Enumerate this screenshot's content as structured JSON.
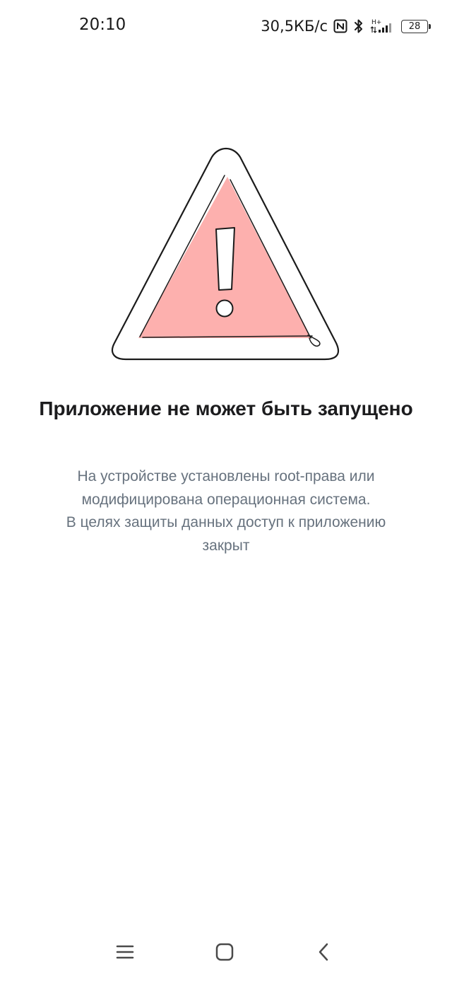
{
  "status_bar": {
    "time": "20:10",
    "network_speed": "30,5КБ/с",
    "network_type": "H+",
    "battery_level": "28",
    "icons": [
      "nfc-icon",
      "bluetooth-icon",
      "signal-icon",
      "battery-icon"
    ]
  },
  "illustration": {
    "icon": "warning-triangle-icon",
    "fill_color": "#fdb0ae",
    "stroke_color": "#1b1b1b"
  },
  "error": {
    "title": "Приложение не может быть запущено",
    "message_lines": [
      "На устройстве установлены root-права или",
      "модифицирована операционная система.",
      "В целях защиты данных доступ к приложению",
      "закрыт"
    ]
  },
  "navigation": {
    "items": [
      {
        "name": "menu-icon"
      },
      {
        "name": "home-icon"
      },
      {
        "name": "back-icon"
      }
    ]
  },
  "colors": {
    "title": "#1c1c1e",
    "message": "#67727e",
    "background": "#ffffff"
  }
}
